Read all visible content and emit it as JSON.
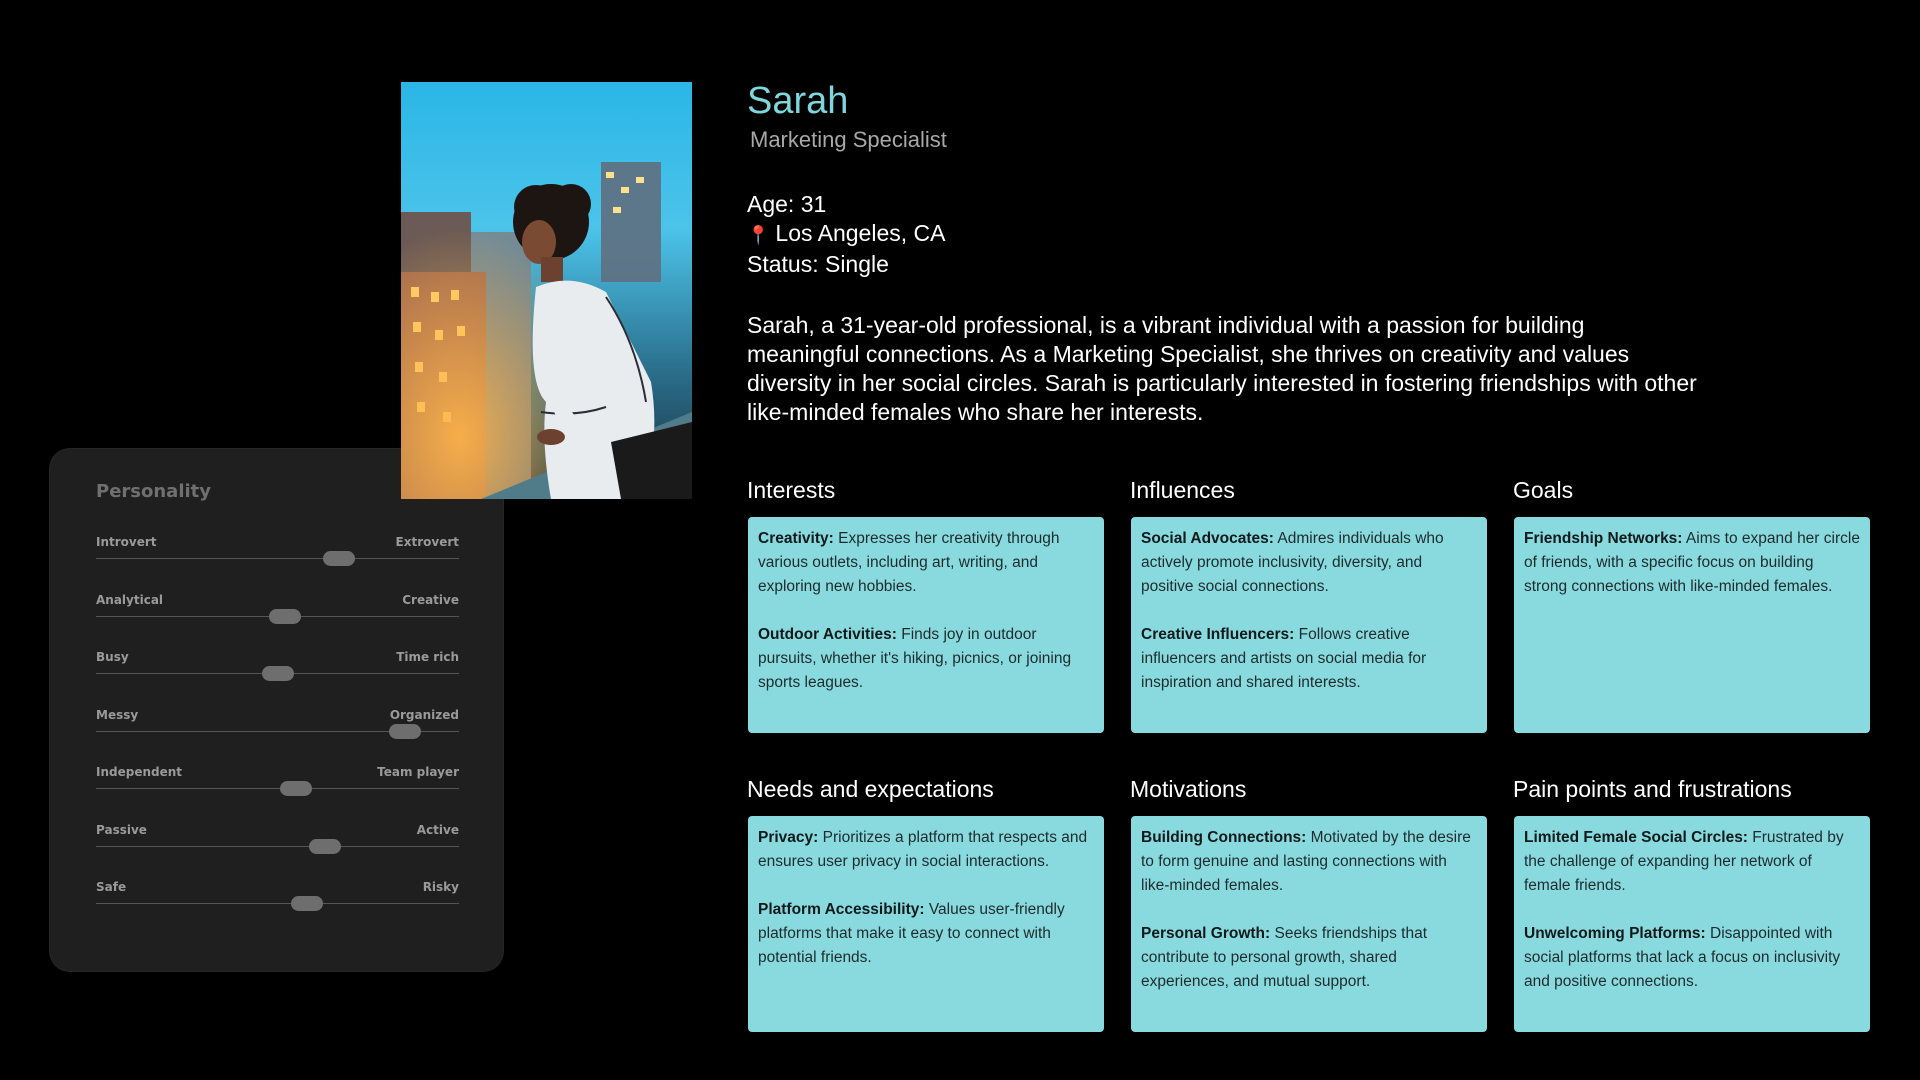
{
  "profile": {
    "name": "Sarah",
    "role": "Marketing Specialist",
    "age": "Age: 31",
    "location_icon": "pin-icon",
    "location": "Los Angeles, CA",
    "status": "Status: Single",
    "bio": "Sarah, a 31-year-old professional, is a vibrant individual with a passion for building meaningful connections. As a Marketing Specialist, she thrives on creativity and values diversity in her social circles. Sarah is particularly interested in fostering friendships with other like-minded females who share her interests.",
    "photo_description": "woman-on-balcony-photo"
  },
  "colors": {
    "background": "#000000",
    "accent": "#7fd6dc",
    "card": "#88dadf",
    "panel": "#1f1f1f"
  },
  "personality": {
    "title": "Personality",
    "traits": [
      {
        "left": "Introvert",
        "right": "Extrovert",
        "value": 0.67
      },
      {
        "left": "Analytical",
        "right": "Creative",
        "value": 0.52
      },
      {
        "left": "Busy",
        "right": "Time rich",
        "value": 0.5
      },
      {
        "left": "Messy",
        "right": "Organized",
        "value": 0.85
      },
      {
        "left": "Independent",
        "right": "Team player",
        "value": 0.55
      },
      {
        "left": "Passive",
        "right": "Active",
        "value": 0.63
      },
      {
        "left": "Safe",
        "right": "Risky",
        "value": 0.58
      }
    ]
  },
  "sections": {
    "interests": {
      "title": "Interests",
      "items": [
        {
          "heading": "Creativity:",
          "text": "Expresses her creativity through various outlets, including art, writing, and exploring new hobbies."
        },
        {
          "heading": "Outdoor Activities:",
          "text": "Finds joy in outdoor pursuits, whether it's hiking, picnics, or joining sports leagues."
        }
      ]
    },
    "influences": {
      "title": "Influences",
      "items": [
        {
          "heading": "Social Advocates:",
          "text": "Admires individuals who actively promote inclusivity, diversity, and positive social connections."
        },
        {
          "heading": "Creative Influencers:",
          "text": "Follows creative influencers and artists on social media for inspiration and shared interests."
        }
      ]
    },
    "goals": {
      "title": "Goals",
      "items": [
        {
          "heading": "Friendship Networks:",
          "text": "Aims to expand her circle of friends, with a specific focus on building strong connections with like-minded females."
        }
      ]
    },
    "needs": {
      "title": "Needs and expectations",
      "items": [
        {
          "heading": "Privacy:",
          "text": "Prioritizes a platform that respects and ensures user privacy in social interactions."
        },
        {
          "heading": "Platform Accessibility:",
          "text": "Values user-friendly platforms that make it easy to connect with potential friends."
        }
      ]
    },
    "motivations": {
      "title": "Motivations",
      "items": [
        {
          "heading": "Building Connections:",
          "text": "Motivated by the desire to form genuine and lasting connections with like-minded females."
        },
        {
          "heading": "Personal Growth:",
          "text": "Seeks friendships that contribute to personal growth, shared experiences, and mutual support."
        }
      ]
    },
    "pain_points": {
      "title": "Pain points and frustrations",
      "items": [
        {
          "heading": "Limited Female Social Circles:",
          "text": "Frustrated by the challenge of expanding her network of female friends."
        },
        {
          "heading": "Unwelcoming Platforms:",
          "text": "Disappointed with social platforms that lack a focus on inclusivity and positive connections."
        }
      ]
    }
  }
}
